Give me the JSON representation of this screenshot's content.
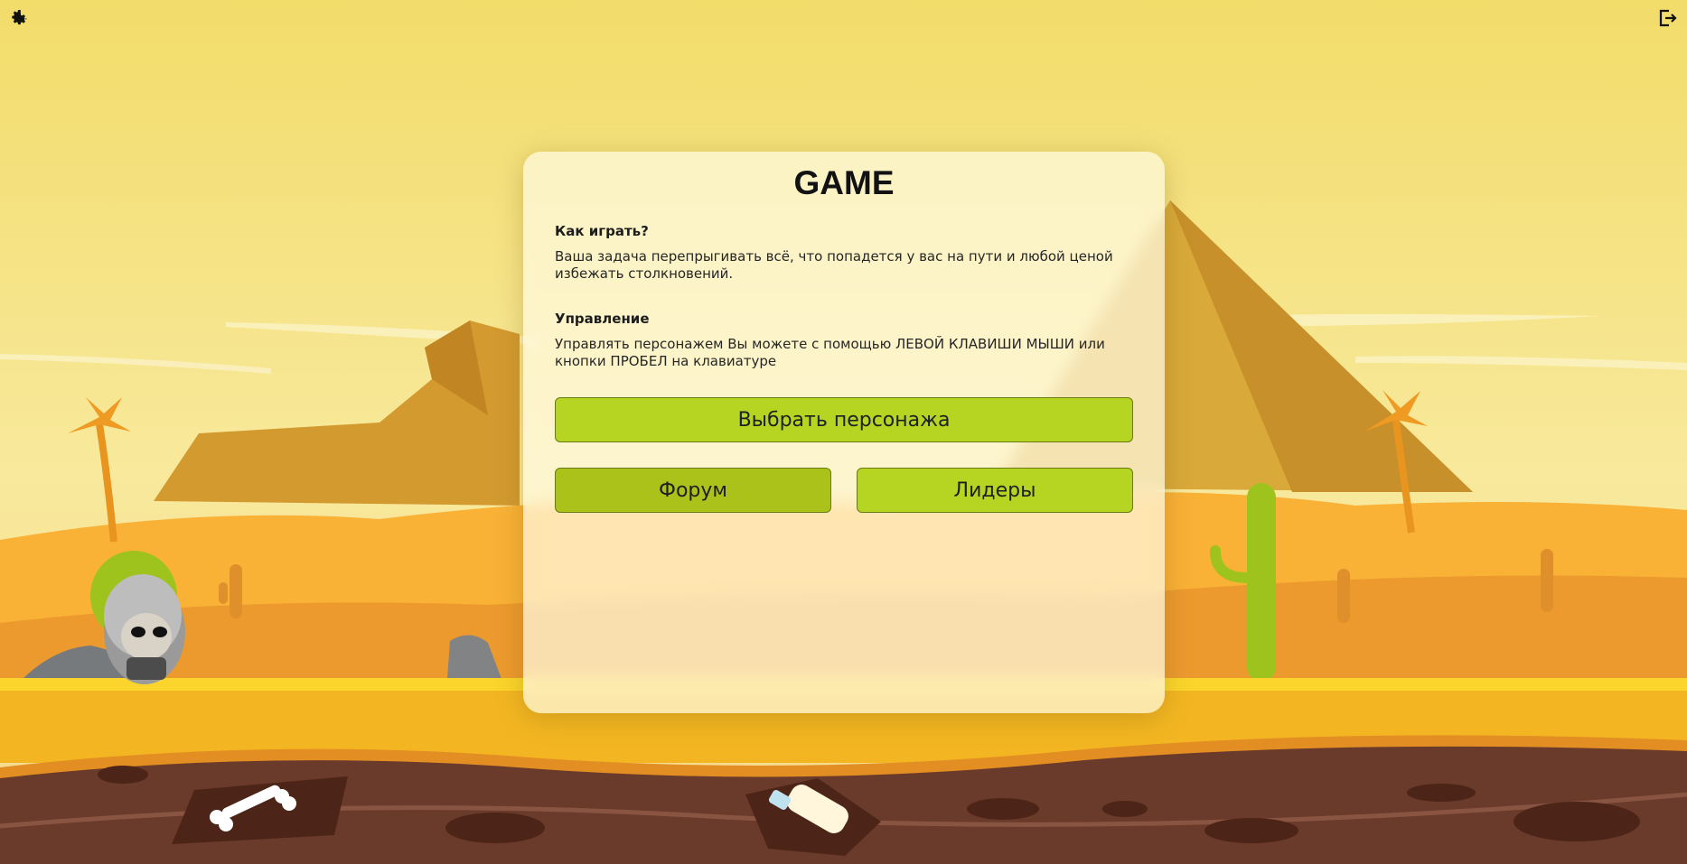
{
  "icons": {
    "settings": "gear-icon",
    "logout": "logout-icon"
  },
  "modal": {
    "title": "GAME",
    "how_to_play": {
      "title": "Как играть?",
      "text": "Ваша задача перепрыгивать всё, что попадется у вас на пути и любой ценой избежать столкновений."
    },
    "controls": {
      "title": "Управление",
      "text": "Управлять персонажем Вы можете с помощью ЛЕВОЙ КЛАВИШИ МЫШИ или кнопки ПРОБЕЛ на клавиатуре"
    },
    "buttons": {
      "choose_character": "Выбрать персонажа",
      "forum": "Форум",
      "leaders": "Лидеры"
    }
  },
  "colors": {
    "sky": "#f3dc6c",
    "accent_button": "#b6d422",
    "ground": "#f3b622",
    "soil": "#6a3a2a"
  }
}
